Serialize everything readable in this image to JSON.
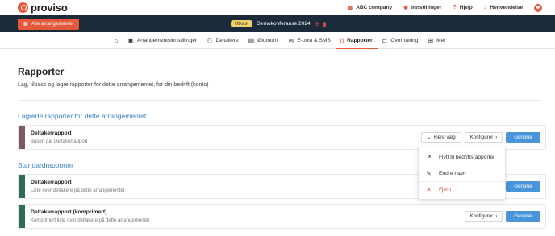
{
  "brand": {
    "name": "proviso"
  },
  "top_links": [
    {
      "icon": "building-icon",
      "glyph": "▦",
      "label": "ABC company"
    },
    {
      "icon": "gear-icon",
      "glyph": "✹",
      "label": "Innstillinger"
    },
    {
      "icon": "help-icon",
      "glyph": "?",
      "label": "Hjelp"
    },
    {
      "icon": "bell-icon",
      "glyph": "♪",
      "label": "Henvendelse"
    }
  ],
  "event_bar": {
    "all_events_label": "Alle arrangementer",
    "status_badge": "Utkast",
    "event_title": "Demokonferanse 2024"
  },
  "nav": {
    "items": [
      {
        "key": "home",
        "label": "",
        "glyph": "⌂"
      },
      {
        "key": "settings",
        "label": "Arrangementsinnstillinger",
        "glyph": "▣"
      },
      {
        "key": "participants",
        "label": "Deltakere",
        "glyph": "⚇"
      },
      {
        "key": "economy",
        "label": "Økonomi",
        "glyph": "▤"
      },
      {
        "key": "email-sms",
        "label": "E-post & SMS",
        "glyph": "✉"
      },
      {
        "key": "reports",
        "label": "Rapporter",
        "glyph": "▯"
      },
      {
        "key": "accommodation",
        "label": "Overnatting",
        "glyph": "⊏"
      },
      {
        "key": "more",
        "label": "Mer",
        "glyph": "⊞"
      }
    ],
    "active": "reports"
  },
  "page": {
    "title": "Rapporter",
    "subtitle": "Lag, tilpass og lagre rapporter for dette arrangementet, for din bedrift (konto)"
  },
  "saved_section": {
    "title": "Lagrede rapporter for dette arrangementet",
    "reports": [
      {
        "title": "Deltakerrapport",
        "description": "Basert på: Deltakerrapport",
        "stripe_color": "#7b5a63",
        "more_label": "Flere valg",
        "configure_label": "Konfigurer",
        "generate_label": "Generer"
      }
    ]
  },
  "standard_section": {
    "title": "Standardrapporter",
    "reports": [
      {
        "title": "Deltakerrapport",
        "description": "Liste over deltakere på dette arrangementet",
        "stripe_color": "#2f6b5a",
        "generate_label": "Generer"
      },
      {
        "title": "Deltakerrapport (komprimert)",
        "description": "Komprimert liste over deltakere på dette arrangementet",
        "stripe_color": "#2f6b5a",
        "configure_label": "Konfigurer",
        "generate_label": "Generer"
      }
    ]
  },
  "dropdown": {
    "items": [
      {
        "label": "Flytt til bedriftsrapporter",
        "icon": "arrow-up-right-icon",
        "glyph": "↗"
      },
      {
        "label": "Endre navn",
        "icon": "pen-icon",
        "glyph": "✎"
      },
      {
        "label": "Fjern",
        "icon": "close-icon",
        "glyph": "✕"
      }
    ]
  },
  "colors": {
    "accent": "#e8593c",
    "primary": "#4a94db",
    "dark_bar": "#1c2b3a",
    "section_title": "#3b82c4"
  }
}
